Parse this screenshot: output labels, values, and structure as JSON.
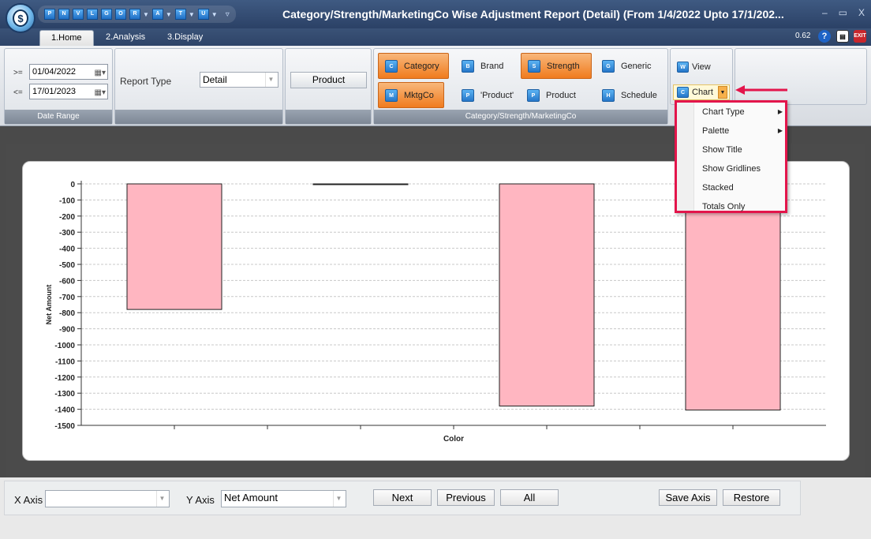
{
  "window": {
    "title": "Category/Strength/MarketingCo Wise Adjustment Report (Detail)  (From 1/4/2022 Upto 17/1/202...",
    "version": "0.62",
    "orb_label": "$",
    "controls": [
      "–",
      "▭",
      "X"
    ]
  },
  "qat": {
    "items": [
      {
        "code": "P",
        "dropdown": false
      },
      {
        "code": "N",
        "dropdown": false
      },
      {
        "code": "V",
        "dropdown": false
      },
      {
        "code": "L",
        "dropdown": false
      },
      {
        "code": "G",
        "dropdown": false
      },
      {
        "code": "O",
        "dropdown": false
      },
      {
        "code": "R",
        "dropdown": true
      },
      {
        "code": "A",
        "dropdown": true
      },
      {
        "code": "T",
        "dropdown": true
      },
      {
        "code": "U",
        "dropdown": true
      }
    ],
    "customize": "▿"
  },
  "tabs": [
    "1.Home",
    "2.Analysis",
    "3.Display"
  ],
  "ribbon": {
    "date_range": {
      "from_label": ">=",
      "from_value": "01/04/2022",
      "to_label": "<=",
      "to_value": "17/01/2023",
      "group_label": "Date Range"
    },
    "report_type": {
      "label": "Report Type",
      "value": "Detail"
    },
    "product_button": "Product",
    "category_group": {
      "label": "Category/Strength/MarketingCo",
      "buttons": [
        {
          "label": "Category",
          "active": true
        },
        {
          "label": "Brand",
          "active": false
        },
        {
          "label": "Strength",
          "active": true
        },
        {
          "label": "Generic",
          "active": false
        },
        {
          "label": "MktgCo",
          "active": true
        },
        {
          "label": "'Product'",
          "active": false
        },
        {
          "label": "Product",
          "active": false
        },
        {
          "label": "Schedule",
          "active": false
        }
      ]
    },
    "view_button": "View",
    "chart_button": "Chart"
  },
  "chart_menu": {
    "items": [
      {
        "label": "Chart Type",
        "submenu": true
      },
      {
        "label": "Palette",
        "submenu": true
      },
      {
        "label": "Show Title",
        "submenu": false
      },
      {
        "label": "Show Gridlines",
        "submenu": false
      },
      {
        "label": "Stacked",
        "submenu": false
      },
      {
        "label": "Totals Only",
        "submenu": false
      }
    ]
  },
  "chart_data": {
    "type": "bar",
    "categories": [
      "",
      "",
      "",
      ""
    ],
    "values": [
      -780,
      0,
      -1380,
      -1405
    ],
    "xlabel": "Color",
    "ylabel": "Net Amount",
    "ylim": [
      -1500,
      0
    ],
    "yticks": [
      0,
      -100,
      -200,
      -300,
      -400,
      -500,
      -600,
      -700,
      -800,
      -900,
      -1000,
      -1100,
      -1200,
      -1300,
      -1400,
      -1500
    ],
    "grid": true,
    "bar_color": "#ffb6c1"
  },
  "bottom": {
    "x_axis_label": "X Axis",
    "x_axis_value": "",
    "y_axis_label": "Y Axis",
    "y_axis_value": "Net Amount",
    "buttons": [
      "Next",
      "Previous",
      "All",
      "Save Axis",
      "Restore"
    ]
  }
}
